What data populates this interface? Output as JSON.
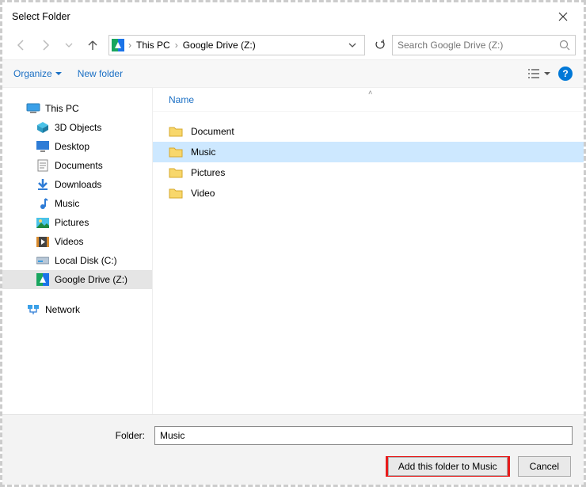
{
  "title": "Select Folder",
  "nav": {
    "breadcrumbs": [
      "This PC",
      "Google Drive (Z:)"
    ]
  },
  "search": {
    "placeholder": "Search Google Drive (Z:)"
  },
  "toolbar": {
    "organize": "Organize",
    "new_folder": "New folder"
  },
  "tree": {
    "roots": [
      {
        "label": "This PC",
        "icon": "pc-icon"
      }
    ],
    "subs": [
      {
        "label": "3D Objects",
        "icon": "3d-icon"
      },
      {
        "label": "Desktop",
        "icon": "desktop-icon"
      },
      {
        "label": "Documents",
        "icon": "documents-icon"
      },
      {
        "label": "Downloads",
        "icon": "downloads-icon"
      },
      {
        "label": "Music",
        "icon": "music-icon"
      },
      {
        "label": "Pictures",
        "icon": "pictures-icon"
      },
      {
        "label": "Videos",
        "icon": "videos-icon"
      },
      {
        "label": "Local Disk (C:)",
        "icon": "disk-icon"
      },
      {
        "label": "Google Drive (Z:)",
        "icon": "gdrive-icon",
        "selected": true
      }
    ],
    "network": {
      "label": "Network",
      "icon": "network-icon"
    }
  },
  "columns": {
    "name": "Name"
  },
  "files": [
    {
      "name": "Document",
      "selected": false
    },
    {
      "name": "Music",
      "selected": true
    },
    {
      "name": "Pictures",
      "selected": false
    },
    {
      "name": "Video",
      "selected": false
    }
  ],
  "footer": {
    "folder_label": "Folder:",
    "folder_value": "Music",
    "primary": "Add this folder to Music",
    "cancel": "Cancel"
  }
}
